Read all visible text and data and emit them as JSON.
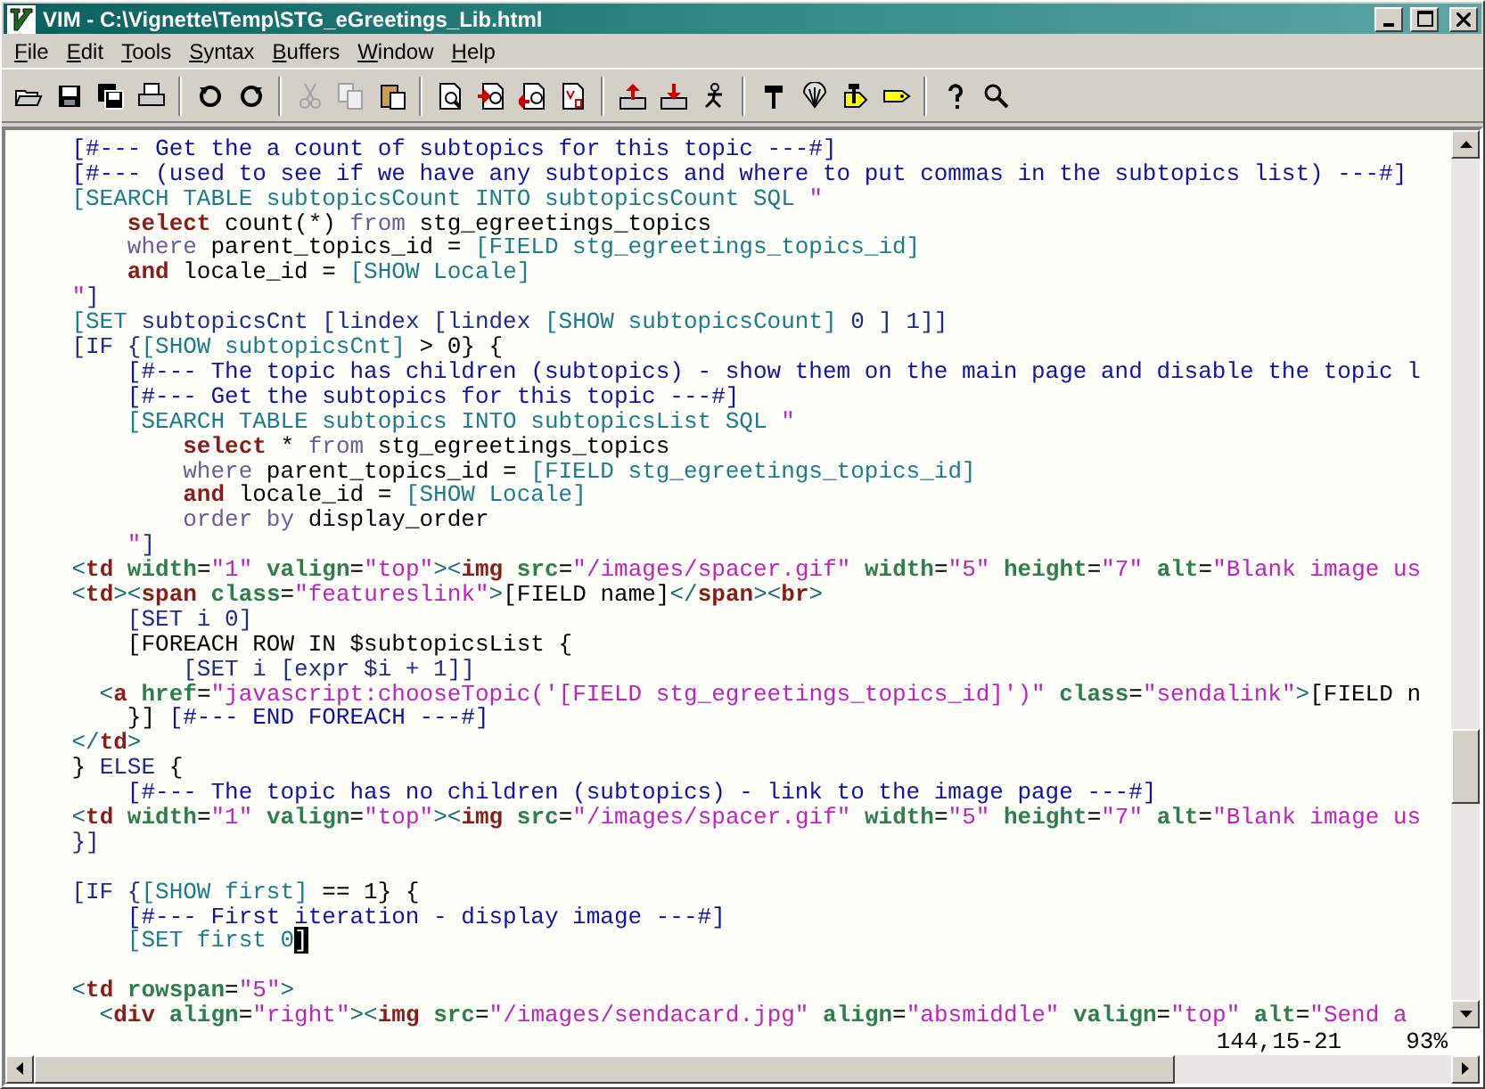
{
  "window": {
    "title": "VIM - C:\\Vignette\\Temp\\STG_eGreetings_Lib.html"
  },
  "menu": [
    {
      "label": "File"
    },
    {
      "label": "Edit"
    },
    {
      "label": "Tools"
    },
    {
      "label": "Syntax"
    },
    {
      "label": "Buffers"
    },
    {
      "label": "Window"
    },
    {
      "label": "Help"
    }
  ],
  "toolbar": [
    {
      "kind": "open",
      "disabled": false
    },
    {
      "kind": "save",
      "disabled": false
    },
    {
      "kind": "save-all",
      "disabled": false
    },
    {
      "kind": "print",
      "disabled": false
    },
    {
      "kind": "separator"
    },
    {
      "kind": "undo",
      "disabled": false
    },
    {
      "kind": "redo",
      "disabled": false
    },
    {
      "kind": "separator"
    },
    {
      "kind": "cut",
      "disabled": true
    },
    {
      "kind": "copy",
      "disabled": true
    },
    {
      "kind": "paste",
      "disabled": false
    },
    {
      "kind": "separator"
    },
    {
      "kind": "find",
      "disabled": false
    },
    {
      "kind": "find-next",
      "disabled": false
    },
    {
      "kind": "find-prev",
      "disabled": false
    },
    {
      "kind": "replace",
      "disabled": false
    },
    {
      "kind": "separator"
    },
    {
      "kind": "load-session",
      "disabled": false
    },
    {
      "kind": "save-session",
      "disabled": false
    },
    {
      "kind": "run-script",
      "disabled": false
    },
    {
      "kind": "separator"
    },
    {
      "kind": "make",
      "disabled": false
    },
    {
      "kind": "shell",
      "disabled": false
    },
    {
      "kind": "tag-jump",
      "disabled": false
    },
    {
      "kind": "tag",
      "disabled": false
    },
    {
      "kind": "separator"
    },
    {
      "kind": "help",
      "disabled": false
    },
    {
      "kind": "find-help",
      "disabled": false
    }
  ],
  "editor": {
    "lines": [
      {
        "segments": [
          {
            "kind": "comment",
            "text": "    [#--- Get the a count of subtopics for this topic ---#]"
          }
        ]
      },
      {
        "segments": [
          {
            "kind": "comment",
            "text": "    [#--- (used to see if we have any subtopics and where to put commas in the subtopics list) ---#]"
          }
        ]
      },
      {
        "segments": [
          {
            "kind": "command",
            "text": "    [SEARCH TABLE subtopicsCount INTO subtopicsCount SQL "
          },
          {
            "kind": "quote",
            "text": "\""
          }
        ]
      },
      {
        "segments": [
          {
            "kind": "keyword",
            "text": "        select"
          },
          {
            "kind": "plain",
            "text": " count(*) "
          },
          {
            "kind": "clause",
            "text": "from"
          },
          {
            "kind": "plain",
            "text": " stg_egreetings_topics"
          }
        ]
      },
      {
        "segments": [
          {
            "kind": "clause",
            "text": "        where"
          },
          {
            "kind": "plain",
            "text": " parent_topics_id = "
          },
          {
            "kind": "command",
            "text": "[FIELD stg_egreetings_topics_id]"
          }
        ]
      },
      {
        "segments": [
          {
            "kind": "keyword",
            "text": "        and"
          },
          {
            "kind": "plain",
            "text": " locale_id = "
          },
          {
            "kind": "command",
            "text": "[SHOW Locale]"
          }
        ]
      },
      {
        "segments": [
          {
            "kind": "quote",
            "text": "    \""
          },
          {
            "kind": "statement",
            "text": "]"
          }
        ]
      },
      {
        "segments": [
          {
            "kind": "command",
            "text": "    [SET"
          },
          {
            "kind": "statement",
            "text": " subtopicsCnt [lindex [lindex "
          },
          {
            "kind": "command",
            "text": "[SHOW subtopicsCount]"
          },
          {
            "kind": "statement",
            "text": " 0 ] 1]]"
          }
        ]
      },
      {
        "segments": [
          {
            "kind": "statement",
            "text": "    [IF {"
          },
          {
            "kind": "command",
            "text": "[SHOW subtopicsCnt]"
          },
          {
            "kind": "plain",
            "text": " > 0} {"
          }
        ]
      },
      {
        "segments": [
          {
            "kind": "comment",
            "text": "        [#--- The topic has children (subtopics) - show them on the main page and disable the topic l"
          }
        ]
      },
      {
        "segments": [
          {
            "kind": "comment",
            "text": "        [#--- Get the subtopics for this topic ---#]"
          }
        ]
      },
      {
        "segments": [
          {
            "kind": "command",
            "text": "        [SEARCH TABLE subtopics INTO subtopicsList SQL "
          },
          {
            "kind": "quote",
            "text": "\""
          }
        ]
      },
      {
        "segments": [
          {
            "kind": "keyword",
            "text": "            select"
          },
          {
            "kind": "plain",
            "text": " * "
          },
          {
            "kind": "clause",
            "text": "from"
          },
          {
            "kind": "plain",
            "text": " stg_egreetings_topics"
          }
        ]
      },
      {
        "segments": [
          {
            "kind": "clause",
            "text": "            where"
          },
          {
            "kind": "plain",
            "text": " parent_topics_id = "
          },
          {
            "kind": "command",
            "text": "[FIELD stg_egreetings_topics_id]"
          }
        ]
      },
      {
        "segments": [
          {
            "kind": "keyword",
            "text": "            and"
          },
          {
            "kind": "plain",
            "text": " locale_id = "
          },
          {
            "kind": "command",
            "text": "[SHOW Locale]"
          }
        ]
      },
      {
        "segments": [
          {
            "kind": "clause",
            "text": "            order by"
          },
          {
            "kind": "plain",
            "text": " display_order"
          }
        ]
      },
      {
        "segments": [
          {
            "kind": "quote",
            "text": "        \""
          },
          {
            "kind": "statement",
            "text": "]"
          }
        ]
      },
      {
        "segments": [
          {
            "kind": "punct",
            "text": "    <"
          },
          {
            "kind": "element",
            "text": "td"
          },
          {
            "kind": "attribute",
            "text": " width"
          },
          {
            "kind": "plain",
            "text": "="
          },
          {
            "kind": "string",
            "text": "\"1\""
          },
          {
            "kind": "attribute",
            "text": " valign"
          },
          {
            "kind": "plain",
            "text": "="
          },
          {
            "kind": "string",
            "text": "\"top\""
          },
          {
            "kind": "punct",
            "text": "><"
          },
          {
            "kind": "element",
            "text": "img"
          },
          {
            "kind": "attribute",
            "text": " src"
          },
          {
            "kind": "plain",
            "text": "="
          },
          {
            "kind": "string",
            "text": "\"/images/spacer.gif\""
          },
          {
            "kind": "attribute",
            "text": " width"
          },
          {
            "kind": "plain",
            "text": "="
          },
          {
            "kind": "string",
            "text": "\"5\""
          },
          {
            "kind": "attribute",
            "text": " height"
          },
          {
            "kind": "plain",
            "text": "="
          },
          {
            "kind": "string",
            "text": "\"7\""
          },
          {
            "kind": "attribute",
            "text": " alt"
          },
          {
            "kind": "plain",
            "text": "="
          },
          {
            "kind": "string",
            "text": "\"Blank image us"
          }
        ]
      },
      {
        "segments": [
          {
            "kind": "punct",
            "text": "    <"
          },
          {
            "kind": "element",
            "text": "td"
          },
          {
            "kind": "punct",
            "text": "><"
          },
          {
            "kind": "element",
            "text": "span"
          },
          {
            "kind": "attribute",
            "text": " class"
          },
          {
            "kind": "plain",
            "text": "="
          },
          {
            "kind": "string",
            "text": "\"featureslink\""
          },
          {
            "kind": "punct",
            "text": ">"
          },
          {
            "kind": "plain",
            "text": "[FIELD name]"
          },
          {
            "kind": "punct",
            "text": "</"
          },
          {
            "kind": "element",
            "text": "span"
          },
          {
            "kind": "punct",
            "text": "><"
          },
          {
            "kind": "element",
            "text": "br"
          },
          {
            "kind": "punct",
            "text": ">"
          }
        ]
      },
      {
        "segments": [
          {
            "kind": "statement",
            "text": "        [SET i 0]"
          }
        ]
      },
      {
        "segments": [
          {
            "kind": "plain",
            "text": "        [FOREACH ROW IN $subtopicsList {"
          }
        ]
      },
      {
        "segments": [
          {
            "kind": "statement",
            "text": "            [SET i [expr $i + 1]]"
          }
        ]
      },
      {
        "segments": [
          {
            "kind": "punct",
            "text": "      <"
          },
          {
            "kind": "element",
            "text": "a"
          },
          {
            "kind": "attribute",
            "text": " href"
          },
          {
            "kind": "plain",
            "text": "="
          },
          {
            "kind": "string",
            "text": "\"javascript:chooseTopic('[FIELD stg_egreetings_topics_id]')\""
          },
          {
            "kind": "attribute",
            "text": " class"
          },
          {
            "kind": "plain",
            "text": "="
          },
          {
            "kind": "string",
            "text": "\"sendalink\""
          },
          {
            "kind": "punct",
            "text": ">"
          },
          {
            "kind": "plain",
            "text": "[FIELD n"
          }
        ]
      },
      {
        "segments": [
          {
            "kind": "plain",
            "text": "        }]"
          },
          {
            "kind": "comment",
            "text": " [#--- END FOREACH ---#]"
          }
        ]
      },
      {
        "segments": [
          {
            "kind": "punct",
            "text": "    </"
          },
          {
            "kind": "element",
            "text": "td"
          },
          {
            "kind": "punct",
            "text": ">"
          }
        ]
      },
      {
        "segments": [
          {
            "kind": "plain",
            "text": "    } "
          },
          {
            "kind": "statement",
            "text": "ELSE"
          },
          {
            "kind": "plain",
            "text": " {"
          }
        ]
      },
      {
        "segments": [
          {
            "kind": "comment",
            "text": "        [#--- The topic has no children (subtopics) - link to the image page ---#]"
          }
        ]
      },
      {
        "segments": [
          {
            "kind": "punct",
            "text": "    <"
          },
          {
            "kind": "element",
            "text": "td"
          },
          {
            "kind": "attribute",
            "text": " width"
          },
          {
            "kind": "plain",
            "text": "="
          },
          {
            "kind": "string",
            "text": "\"1\""
          },
          {
            "kind": "attribute",
            "text": " valign"
          },
          {
            "kind": "plain",
            "text": "="
          },
          {
            "kind": "string",
            "text": "\"top\""
          },
          {
            "kind": "punct",
            "text": "><"
          },
          {
            "kind": "element",
            "text": "img"
          },
          {
            "kind": "attribute",
            "text": " src"
          },
          {
            "kind": "plain",
            "text": "="
          },
          {
            "kind": "string",
            "text": "\"/images/spacer.gif\""
          },
          {
            "kind": "attribute",
            "text": " width"
          },
          {
            "kind": "plain",
            "text": "="
          },
          {
            "kind": "string",
            "text": "\"5\""
          },
          {
            "kind": "attribute",
            "text": " height"
          },
          {
            "kind": "plain",
            "text": "="
          },
          {
            "kind": "string",
            "text": "\"7\""
          },
          {
            "kind": "attribute",
            "text": " alt"
          },
          {
            "kind": "plain",
            "text": "="
          },
          {
            "kind": "string",
            "text": "\"Blank image us"
          }
        ]
      },
      {
        "segments": [
          {
            "kind": "statement",
            "text": "    }]"
          }
        ],
        "blank_line_after": true
      },
      {
        "segments": [
          {
            "kind": "statement",
            "text": "    [IF {"
          },
          {
            "kind": "command",
            "text": "[SHOW first]"
          },
          {
            "kind": "plain",
            "text": " == 1} {"
          }
        ]
      },
      {
        "segments": [
          {
            "kind": "comment",
            "text": "        [#--- First iteration - display image ---#]"
          }
        ]
      },
      {
        "segments": [
          {
            "kind": "command",
            "text": "        [SET first 0"
          },
          {
            "kind": "cursor",
            "text": "]"
          }
        ],
        "blank_line_after": true
      },
      {
        "segments": [
          {
            "kind": "punct",
            "text": "    <"
          },
          {
            "kind": "element",
            "text": "td"
          },
          {
            "kind": "attribute",
            "text": " rowspan"
          },
          {
            "kind": "plain",
            "text": "="
          },
          {
            "kind": "string",
            "text": "\"5\""
          },
          {
            "kind": "punct",
            "text": ">"
          }
        ]
      },
      {
        "segments": [
          {
            "kind": "punct",
            "text": "      <"
          },
          {
            "kind": "element",
            "text": "div"
          },
          {
            "kind": "attribute",
            "text": " align"
          },
          {
            "kind": "plain",
            "text": "="
          },
          {
            "kind": "string",
            "text": "\"right\""
          },
          {
            "kind": "punct",
            "text": "><"
          },
          {
            "kind": "element",
            "text": "img"
          },
          {
            "kind": "attribute",
            "text": " src"
          },
          {
            "kind": "plain",
            "text": "="
          },
          {
            "kind": "string",
            "text": "\"/images/sendacard.jpg\""
          },
          {
            "kind": "attribute",
            "text": " align"
          },
          {
            "kind": "plain",
            "text": "="
          },
          {
            "kind": "string",
            "text": "\"absmiddle\""
          },
          {
            "kind": "attribute",
            "text": " valign"
          },
          {
            "kind": "plain",
            "text": "="
          },
          {
            "kind": "string",
            "text": "\"top\""
          },
          {
            "kind": "attribute",
            "text": " alt"
          },
          {
            "kind": "plain",
            "text": "="
          },
          {
            "kind": "string",
            "text": "\"Send a"
          }
        ]
      }
    ],
    "ruler": {
      "position": "144,15-21",
      "percent": "93%"
    }
  }
}
